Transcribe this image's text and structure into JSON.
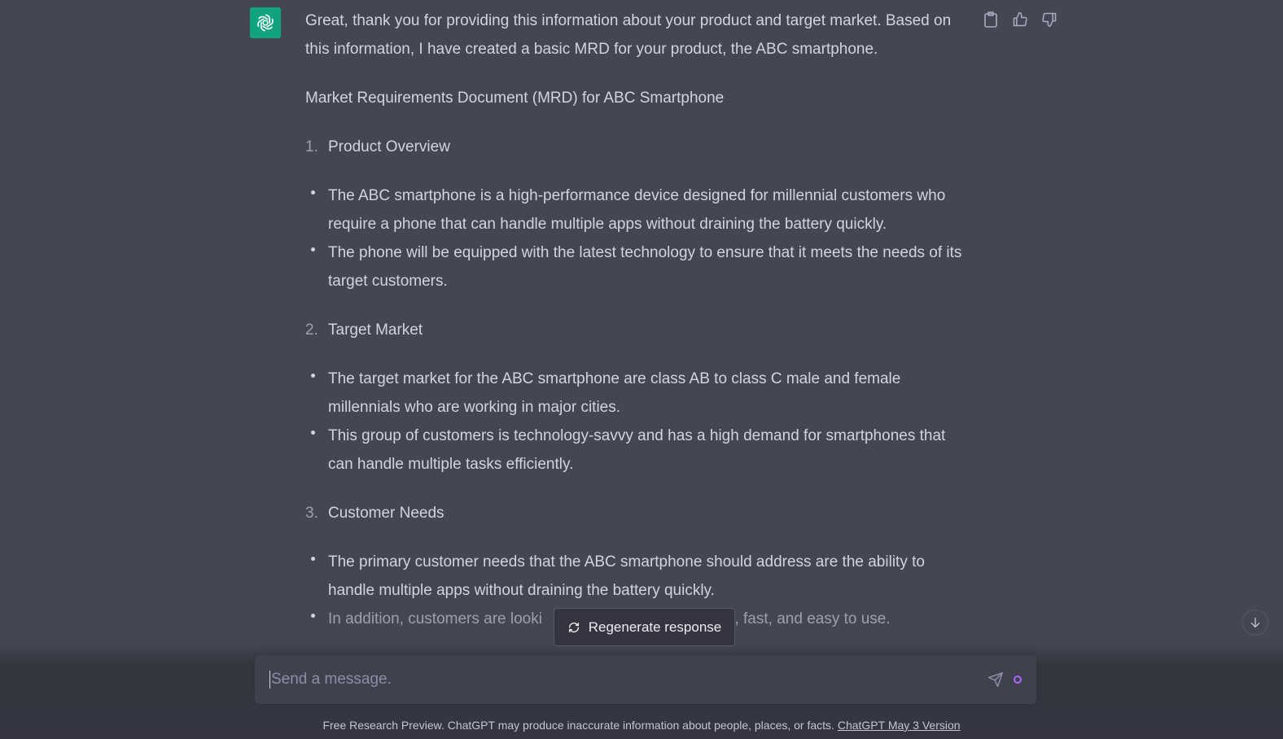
{
  "assistant": {
    "avatar_icon": "openai-logo-icon",
    "avatar_color": "#10a37f"
  },
  "message": {
    "intro": "Great, thank you for providing this information about your product and target market. Based on this information, I have created a basic MRD for your product, the ABC smartphone.",
    "doc_title": "Market Requirements Document (MRD) for ABC Smartphone",
    "sections": [
      {
        "number": "1.",
        "title": "Product Overview",
        "bullets": [
          "The ABC smartphone is a high-performance device designed for millennial customers who require a phone that can handle multiple apps without draining the battery quickly.",
          "The phone will be equipped with the latest technology to ensure that it meets the needs of its target customers."
        ]
      },
      {
        "number": "2.",
        "title": "Target Market",
        "bullets": [
          "The target market for the ABC smartphone are class AB to class C male and female millennials who are working in major cities.",
          "This group of customers is technology-savvy and has a high demand for smartphones that can handle multiple tasks efficiently."
        ]
      },
      {
        "number": "3.",
        "title": "Customer Needs",
        "bullets": [
          "The primary customer needs that the ABC smartphone should address are the ability to handle multiple apps without draining the battery quickly.",
          "In addition, customers are looki                                        ble, fast, and easy to use."
        ]
      }
    ]
  },
  "actions": {
    "copy_icon": "clipboard-icon",
    "like_icon": "thumbs-up-icon",
    "dislike_icon": "thumbs-down-icon"
  },
  "regenerate": {
    "label": "Regenerate response",
    "icon": "refresh-icon"
  },
  "composer": {
    "placeholder": "Send a message.",
    "value": "",
    "send_icon": "send-icon",
    "status_color": "#ab68ff"
  },
  "scroll_button": {
    "icon": "arrow-down-icon"
  },
  "footer": {
    "text": "Free Research Preview. ChatGPT may produce inaccurate information about people, places, or facts. ",
    "link": "ChatGPT May 3 Version"
  }
}
